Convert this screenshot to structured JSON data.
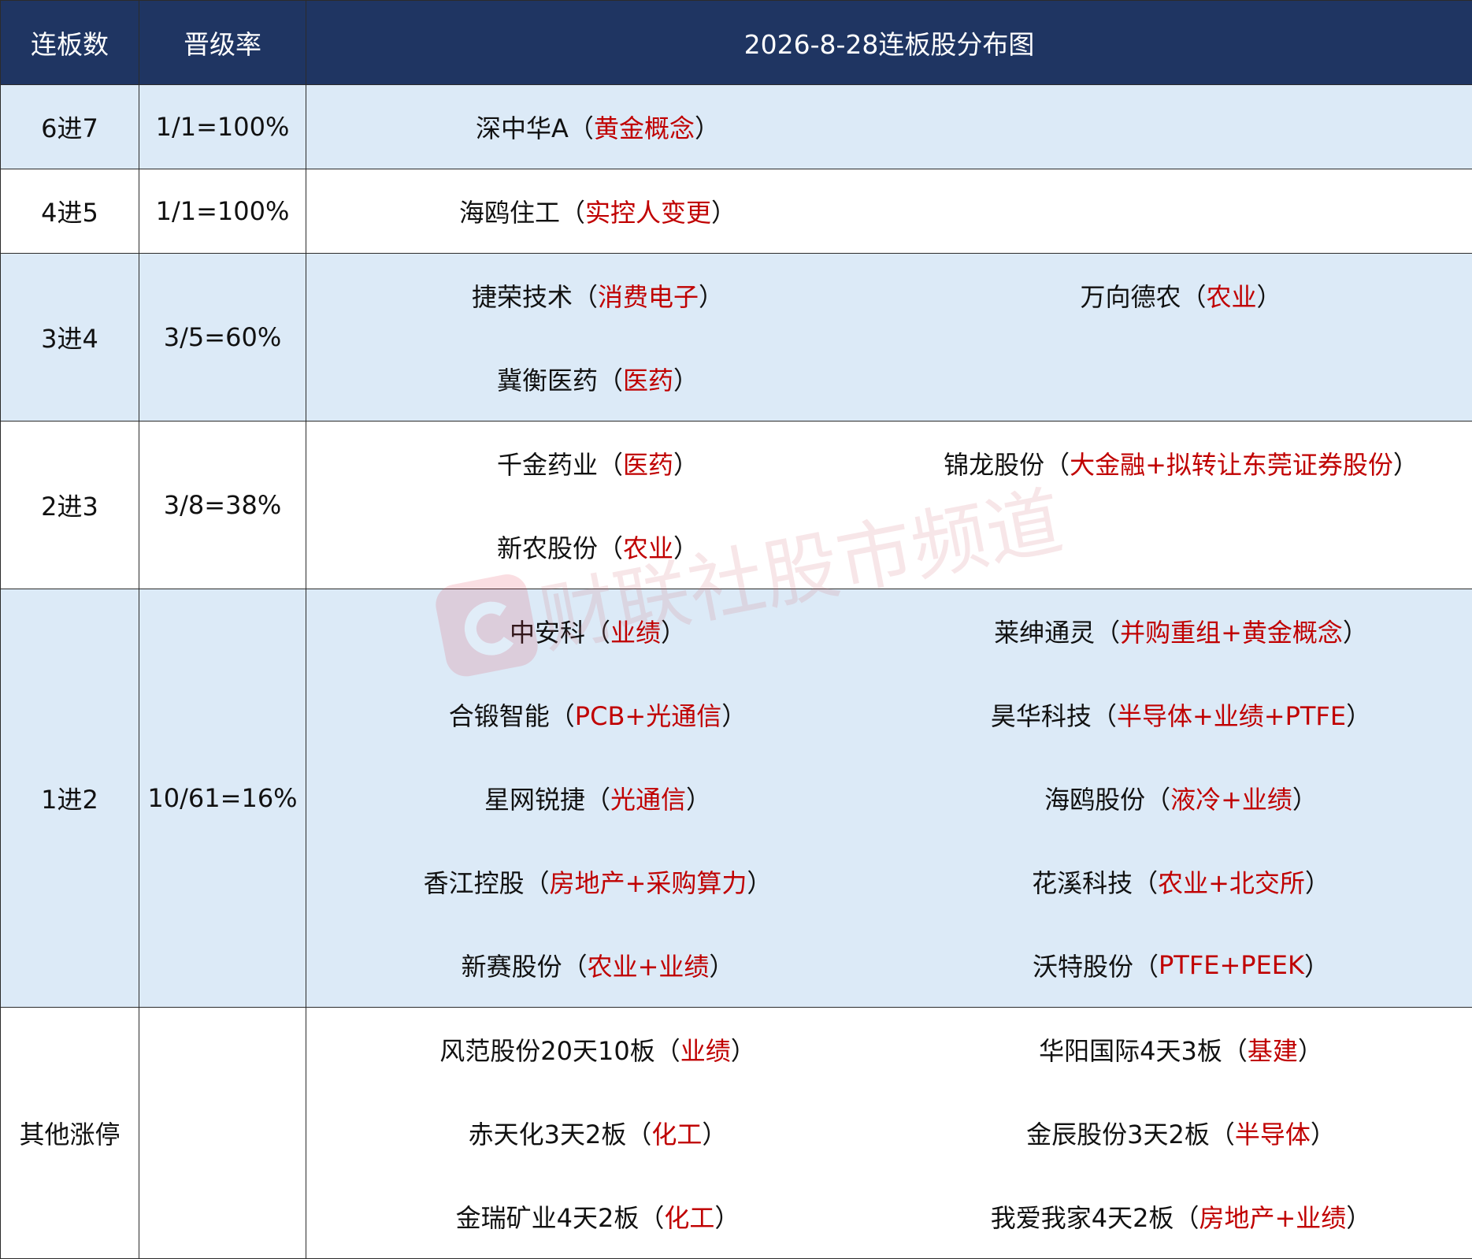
{
  "header": {
    "col_level": "连板数",
    "col_rate": "晋级率",
    "title": "2026-8-28连板股分布图"
  },
  "rows": [
    {
      "level": "6进7",
      "rate": "1/1=100%",
      "band": true,
      "stocks": [
        {
          "name": "深中华A",
          "tag": "黄金概念"
        },
        {
          "name": "",
          "tag": ""
        }
      ]
    },
    {
      "level": "4进5",
      "rate": "1/1=100%",
      "band": false,
      "stocks": [
        {
          "name": "海鸥住工",
          "tag": "实控人变更"
        },
        {
          "name": "",
          "tag": ""
        }
      ]
    },
    {
      "level": "3进4",
      "rate": "3/5=60%",
      "band": true,
      "stocks": [
        {
          "name": "捷荣技术",
          "tag": "消费电子"
        },
        {
          "name": "万向德农",
          "tag": "农业"
        },
        {
          "name": "冀衡医药",
          "tag": "医药"
        },
        {
          "name": "",
          "tag": ""
        }
      ]
    },
    {
      "level": "2进3",
      "rate": "3/8=38%",
      "band": false,
      "stocks": [
        {
          "name": "千金药业",
          "tag": "医药"
        },
        {
          "name": "锦龙股份",
          "tag": "大金融+拟转让东莞证券股份"
        },
        {
          "name": "新农股份",
          "tag": "农业"
        },
        {
          "name": "",
          "tag": ""
        }
      ]
    },
    {
      "level": "1进2",
      "rate": "10/61=16%",
      "band": true,
      "stocks": [
        {
          "name": "中安科",
          "tag": "业绩"
        },
        {
          "name": "莱绅通灵",
          "tag": "并购重组+黄金概念"
        },
        {
          "name": "合锻智能",
          "tag": "PCB+光通信"
        },
        {
          "name": "昊华科技",
          "tag": "半导体+业绩+PTFE"
        },
        {
          "name": "星网锐捷",
          "tag": "光通信"
        },
        {
          "name": "海鸥股份",
          "tag": "液冷+业绩"
        },
        {
          "name": "香江控股",
          "tag": "房地产+采购算力"
        },
        {
          "name": "花溪科技",
          "tag": "农业+北交所"
        },
        {
          "name": "新赛股份",
          "tag": "农业+业绩"
        },
        {
          "name": "沃特股份",
          "tag": "PTFE+PEEK"
        }
      ]
    },
    {
      "level": "其他涨停",
      "rate": "",
      "band": false,
      "stocks": [
        {
          "name": "风范股份20天10板",
          "tag": "业绩"
        },
        {
          "name": "华阳国际4天3板",
          "tag": "基建"
        },
        {
          "name": "赤天化3天2板",
          "tag": "化工"
        },
        {
          "name": "金辰股份3天2板",
          "tag": "半导体"
        },
        {
          "name": "金瑞矿业4天2板",
          "tag": "化工"
        },
        {
          "name": "我爱我家4天2板",
          "tag": "房地产+业绩"
        }
      ]
    }
  ],
  "watermark": "财联社股市频道",
  "colors": {
    "header_bg": "#1f3562",
    "band_bg": "#dceaf7",
    "tag_red": "#c00000",
    "border": "#2b2b2b"
  }
}
